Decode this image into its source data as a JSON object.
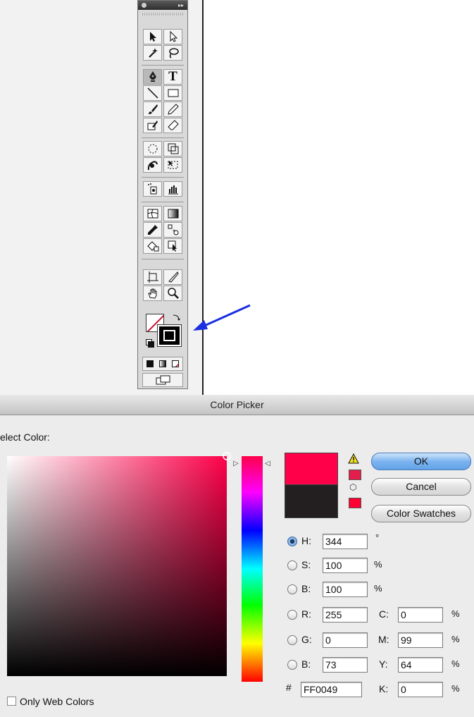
{
  "dialog": {
    "title": "Color Picker",
    "select_label": "elect Color:",
    "buttons": {
      "ok": "OK",
      "cancel": "Cancel",
      "swatches": "Color Swatches"
    },
    "fields": {
      "h": {
        "label": "H:",
        "value": "344",
        "unit": "°"
      },
      "s": {
        "label": "S:",
        "value": "100",
        "unit": "%"
      },
      "b": {
        "label": "B:",
        "value": "100",
        "unit": "%"
      },
      "r": {
        "label": "R:",
        "value": "255"
      },
      "g": {
        "label": "G:",
        "value": "0"
      },
      "bl": {
        "label": "B:",
        "value": "73"
      },
      "c": {
        "label": "C:",
        "value": "0",
        "unit": "%"
      },
      "m": {
        "label": "M:",
        "value": "99",
        "unit": "%"
      },
      "y": {
        "label": "Y:",
        "value": "64",
        "unit": "%"
      },
      "k": {
        "label": "K:",
        "value": "0",
        "unit": "%"
      },
      "hex": {
        "label": "#",
        "value": "FF0049"
      }
    },
    "selected_mode": "H",
    "web_colors_label": "Only Web Colors",
    "colors": {
      "new": "#ff0049",
      "old": "#231f20",
      "gamut_swatch": "#e41e4a",
      "web_swatch": "#ff0033"
    }
  },
  "toolbox": {
    "text_tool_glyph": "T",
    "tools": [
      "selection-tool",
      "direct-selection-tool",
      "magic-wand-tool",
      "lasso-tool",
      "pen-tool",
      "type-tool",
      "line-tool",
      "rectangle-tool",
      "paintbrush-tool",
      "pencil-tool",
      "blob-brush-tool",
      "eraser-tool",
      "rotate-tool",
      "scale-tool",
      "warp-tool",
      "free-transform-tool",
      "symbol-sprayer-tool",
      "graph-tool",
      "mesh-tool",
      "gradient-tool",
      "eyedropper-tool",
      "blend-tool",
      "live-paint-bucket-tool",
      "live-paint-selection-tool",
      "artboard-tool",
      "slice-tool",
      "hand-tool",
      "zoom-tool"
    ]
  },
  "annotation": {
    "arrow_color": "#1a2fe0"
  }
}
